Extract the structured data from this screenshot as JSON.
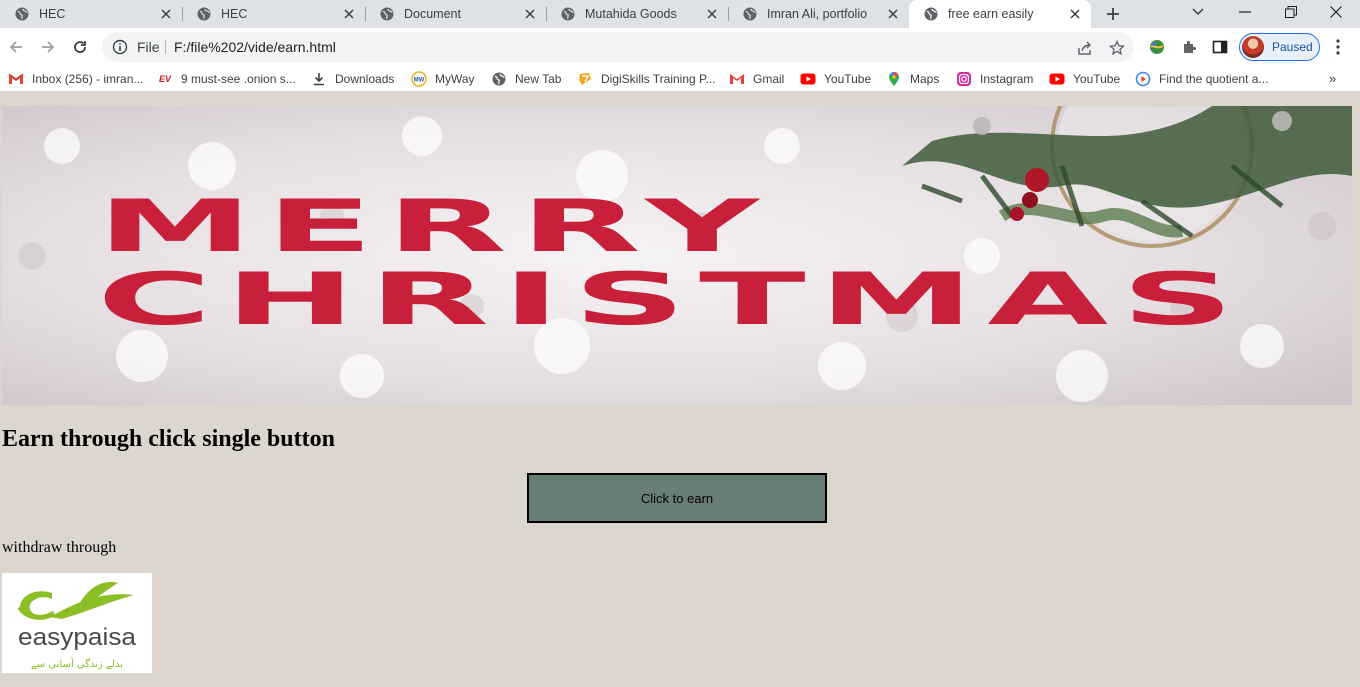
{
  "browser": {
    "tabs": [
      {
        "title": "HEC",
        "active": false
      },
      {
        "title": "HEC",
        "active": false
      },
      {
        "title": "Document",
        "active": false
      },
      {
        "title": "Mutahida Goods",
        "active": false
      },
      {
        "title": "Imran Ali, portfolio",
        "active": false
      },
      {
        "title": "free earn easily",
        "active": true
      }
    ],
    "address": {
      "scheme_label": "File",
      "url": "F:/file%202/vide/earn.html"
    },
    "profile": {
      "label": "Paused"
    },
    "bookmarks": [
      {
        "label": "Inbox (256) - imran...",
        "icon": "gmail-icon"
      },
      {
        "label": "9 must-see .onion s...",
        "icon": "ev-icon"
      },
      {
        "label": "Downloads",
        "icon": "download-icon"
      },
      {
        "label": "MyWay",
        "icon": "myway-icon"
      },
      {
        "label": "New Tab",
        "icon": "globe-icon"
      },
      {
        "label": "DigiSkills Training P...",
        "icon": "digiskills-icon"
      },
      {
        "label": "Gmail",
        "icon": "gmail-icon"
      },
      {
        "label": "YouTube",
        "icon": "youtube-icon"
      },
      {
        "label": "Maps",
        "icon": "maps-icon"
      },
      {
        "label": "Instagram",
        "icon": "instagram-icon"
      },
      {
        "label": "YouTube",
        "icon": "youtube-icon"
      },
      {
        "label": "Find the quotient a...",
        "icon": "quotient-icon"
      }
    ],
    "bookmarks_more": "»"
  },
  "page": {
    "banner": {
      "line1": "MERRY",
      "line2": "CHRISTMAS"
    },
    "heading": "Earn through click single button",
    "button_label": "Click to earn",
    "withdraw_label": "withdraw through",
    "logo": {
      "brand": "easypaisa",
      "tagline": "بدلے زندگی آسانی سے"
    },
    "colors": {
      "page_background": "#dcd6cd",
      "button_background": "#687e74",
      "banner_text": "#c8203a",
      "logo_green": "#8cbf26"
    }
  }
}
